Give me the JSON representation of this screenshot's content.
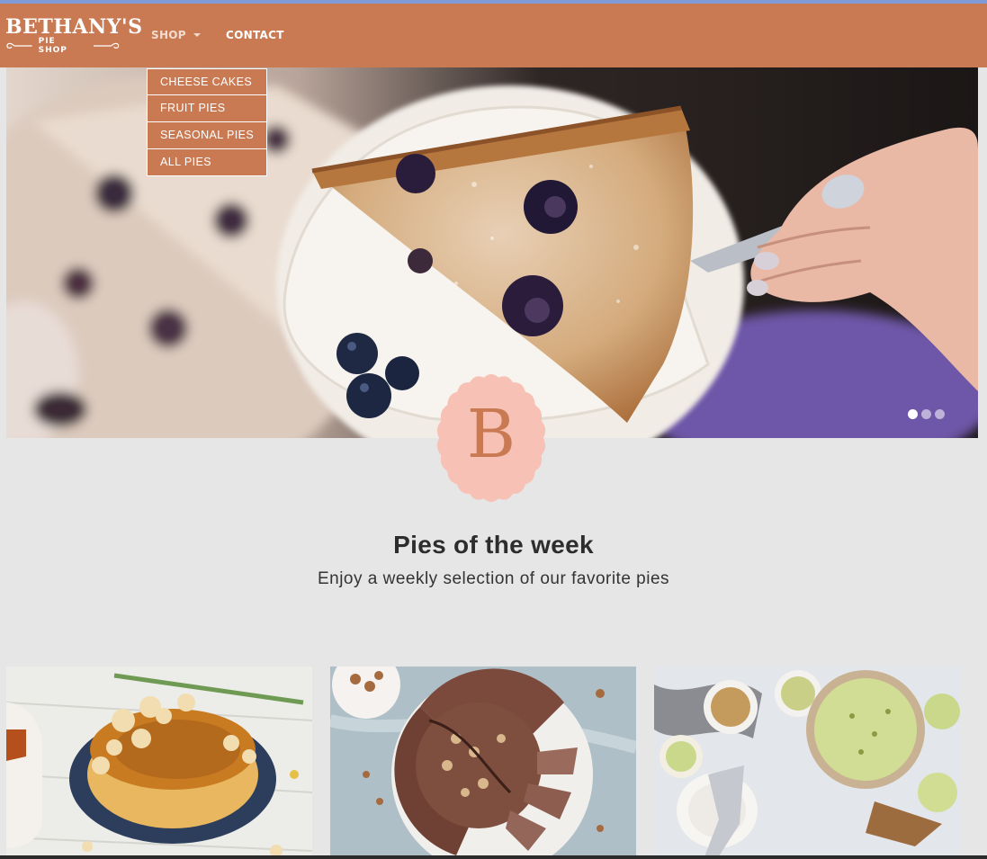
{
  "brand": {
    "name": "BETHANY'S",
    "tagline": "PIE SHOP"
  },
  "nav": {
    "shop_label": "SHOP",
    "contact_label": "CONTACT",
    "shop_menu": [
      "CHEESE CAKES",
      "FRUIT PIES",
      "SEASONAL PIES",
      "ALL PIES"
    ]
  },
  "hero": {
    "image": "blueberry-pie-slice-photo",
    "slides": {
      "count": 3,
      "active_index": 0
    }
  },
  "badge": {
    "letter": "B"
  },
  "section": {
    "title": "Pies of the week",
    "subtitle": "Enjoy a weekly selection of our favorite pies"
  },
  "cards": [
    {
      "image": "caramel-popcorn-cheesecake-photo"
    },
    {
      "image": "chocolate-hazelnut-pie-photo"
    },
    {
      "image": "pistachio-pie-photo"
    }
  ],
  "colors": {
    "navbar": "#c97a52",
    "page_background": "#e6e6e6",
    "badge_pink": "#f7c2b5",
    "badge_letter": "#c97a52"
  }
}
